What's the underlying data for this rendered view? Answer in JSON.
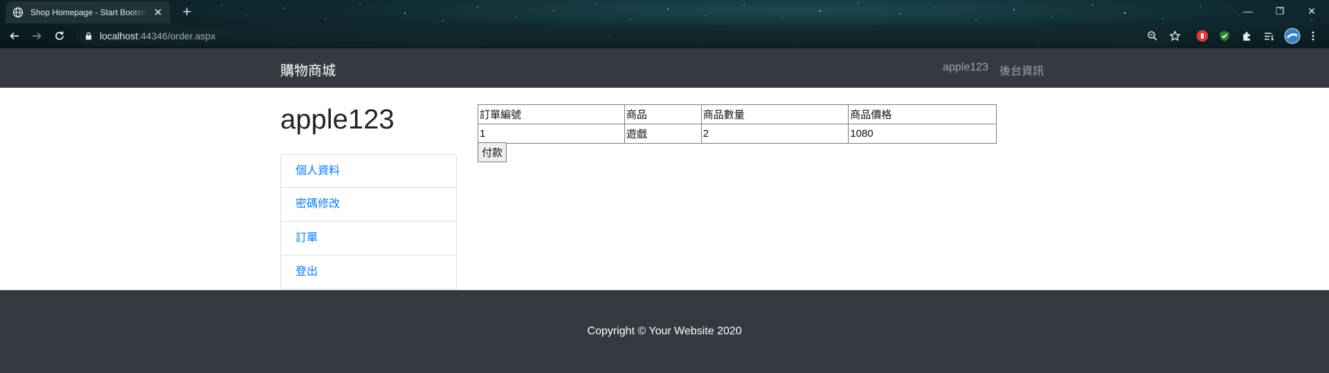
{
  "browser": {
    "tab_title": "Shop Homepage - Start Bootstrap Template",
    "url_host": "localhost",
    "url_rest": ":44346/order.aspx",
    "accent_colors": {
      "ext_red": "#e53935",
      "ext_green": "#2e7d32"
    }
  },
  "site": {
    "brand": "購物商城",
    "nav_links": [
      "apple123",
      "後台資訊"
    ],
    "nav_bg": "#343a40",
    "link_color": "#007bff"
  },
  "sidebar": {
    "heading": "apple123",
    "items": [
      "個人資料",
      "密碼修改",
      "訂單",
      "登出"
    ]
  },
  "orders": {
    "headers": [
      "訂單編號",
      "商品",
      "商品數量",
      "商品價格"
    ],
    "rows": [
      [
        "1",
        "遊戲",
        "2",
        "1080"
      ]
    ],
    "pay_label": "付款"
  },
  "footer": {
    "copyright": "Copyright © Your Website 2020"
  }
}
